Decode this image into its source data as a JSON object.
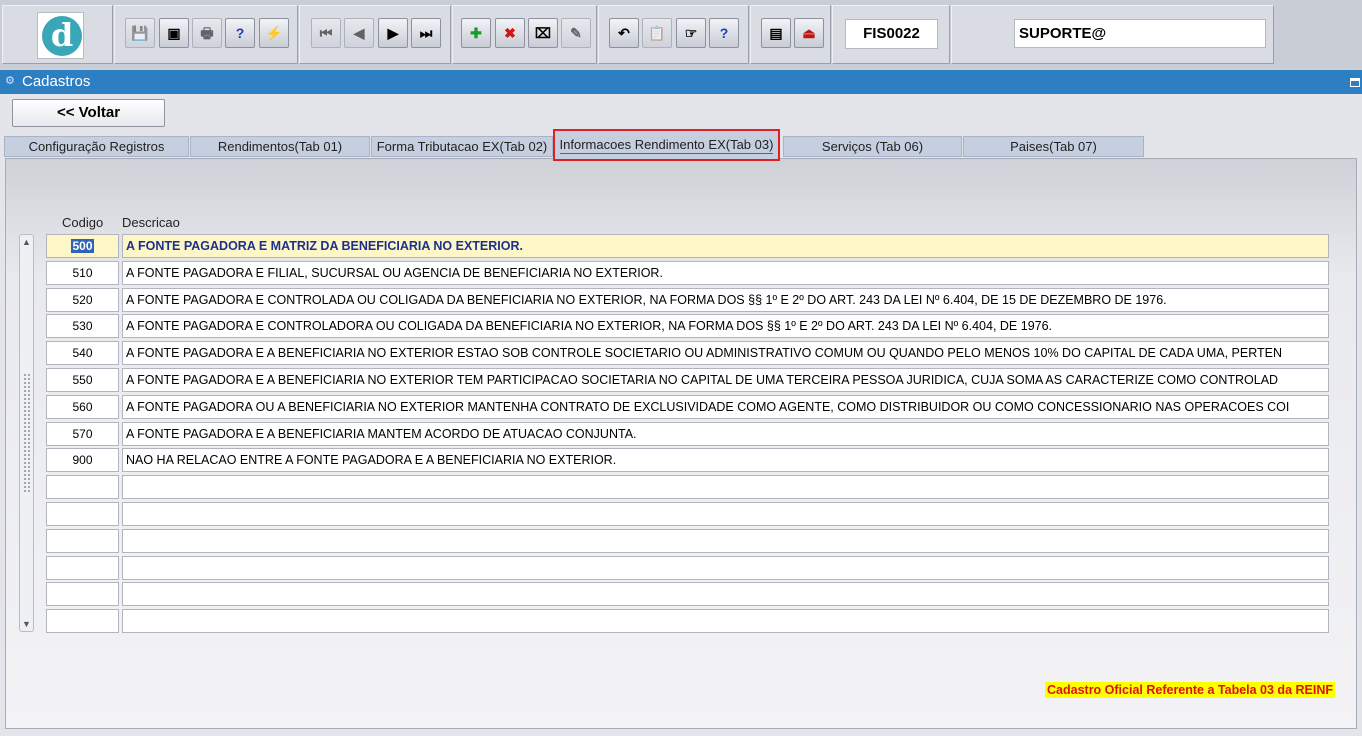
{
  "toolbar": {
    "logo_letter": "d",
    "buttons": [
      {
        "name": "save-icon",
        "glyph": "💾",
        "enabled": false
      },
      {
        "name": "window-icon",
        "glyph": "▣",
        "enabled": true
      },
      {
        "name": "print-icon",
        "glyph": "🖶",
        "enabled": false
      },
      {
        "name": "query-icon",
        "glyph": "?",
        "enabled": true
      },
      {
        "name": "execute-query-icon",
        "glyph": "⚡",
        "enabled": true
      },
      {
        "name": "first-record-icon",
        "glyph": "⏮",
        "enabled": false
      },
      {
        "name": "previous-record-icon",
        "glyph": "◀",
        "enabled": false
      },
      {
        "name": "next-record-icon",
        "glyph": "▶",
        "enabled": true
      },
      {
        "name": "last-record-icon",
        "glyph": "⏭",
        "enabled": true
      },
      {
        "name": "insert-record-icon",
        "glyph": "✚",
        "enabled": true
      },
      {
        "name": "delete-record-icon",
        "glyph": "✖",
        "enabled": true
      },
      {
        "name": "clear-icon",
        "glyph": "⌧",
        "enabled": true
      },
      {
        "name": "edit-icon",
        "glyph": "✎",
        "enabled": false
      },
      {
        "name": "undo-icon",
        "glyph": "↶",
        "enabled": true
      },
      {
        "name": "clipboard-icon",
        "glyph": "📋",
        "enabled": false
      },
      {
        "name": "list-values-icon",
        "glyph": "☞",
        "enabled": true
      },
      {
        "name": "help-icon",
        "glyph": "?",
        "enabled": true
      },
      {
        "name": "menu-icon",
        "glyph": "▤",
        "enabled": true
      },
      {
        "name": "exit-icon",
        "glyph": "⏏",
        "enabled": true
      }
    ],
    "form_code": "FIS0022",
    "user": "SUPORTE@"
  },
  "window": {
    "title": "Cadastros",
    "back_label": "<< Voltar"
  },
  "tabs": [
    {
      "label": "Configuração Registros",
      "active": false
    },
    {
      "label": "Rendimentos(Tab 01)",
      "active": false
    },
    {
      "label": "Forma Tributacao EX(Tab 02)",
      "active": false
    },
    {
      "label": "Informacoes Rendimento EX(Tab 03)",
      "active": true
    },
    {
      "label": "Serviços (Tab 06)",
      "active": false
    },
    {
      "label": "Paises(Tab 07)",
      "active": false
    }
  ],
  "table": {
    "headers": {
      "code": "Codigo",
      "description": "Descricao"
    },
    "rows": [
      {
        "code": "500",
        "description": "A FONTE PAGADORA E MATRIZ DA BENEFICIARIA NO EXTERIOR.",
        "selected": true
      },
      {
        "code": "510",
        "description": "A FONTE PAGADORA E FILIAL, SUCURSAL OU AGENCIA DE BENEFICIARIA NO EXTERIOR."
      },
      {
        "code": "520",
        "description": "A FONTE PAGADORA E CONTROLADA OU COLIGADA DA BENEFICIARIA NO EXTERIOR, NA FORMA DOS §§ 1º E 2º DO ART. 243 DA LEI Nº 6.404, DE 15 DE DEZEMBRO DE 1976."
      },
      {
        "code": "530",
        "description": "A FONTE PAGADORA E CONTROLADORA OU COLIGADA DA BENEFICIARIA NO EXTERIOR, NA FORMA DOS §§ 1º E 2º DO ART. 243 DA LEI Nº 6.404, DE 1976."
      },
      {
        "code": "540",
        "description": "A FONTE PAGADORA E A BENEFICIARIA NO EXTERIOR ESTAO SOB CONTROLE SOCIETARIO OU ADMINISTRATIVO COMUM OU QUANDO PELO MENOS 10% DO CAPITAL DE CADA UMA, PERTEN"
      },
      {
        "code": "550",
        "description": "A FONTE PAGADORA E A BENEFICIARIA NO EXTERIOR TEM PARTICIPACAO SOCIETARIA NO CAPITAL DE UMA TERCEIRA PESSOA JURIDICA, CUJA SOMA AS CARACTERIZE COMO CONTROLAD"
      },
      {
        "code": "560",
        "description": "A FONTE PAGADORA OU A BENEFICIARIA NO EXTERIOR MANTENHA CONTRATO DE EXCLUSIVIDADE COMO AGENTE, COMO DISTRIBUIDOR OU COMO CONCESSIONARIO NAS OPERACOES COI"
      },
      {
        "code": "570",
        "description": "A FONTE PAGADORA E A BENEFICIARIA MANTEM ACORDO DE ATUACAO CONJUNTA."
      },
      {
        "code": "900",
        "description": "NAO HA RELACAO ENTRE A FONTE PAGADORA E A BENEFICIARIA NO EXTERIOR."
      },
      {
        "code": "",
        "description": ""
      },
      {
        "code": "",
        "description": ""
      },
      {
        "code": "",
        "description": ""
      },
      {
        "code": "",
        "description": ""
      },
      {
        "code": "",
        "description": ""
      },
      {
        "code": "",
        "description": ""
      }
    ]
  },
  "footer_note": "Cadastro Oficial Referente a Tabela 03 da REINF",
  "colors": {
    "titlebar": "#2e7ec2",
    "active_tab_highlight": "#e02020",
    "selected_row": "#fdf7c8",
    "note_background": "#ffff00",
    "note_text": "#e01010"
  }
}
